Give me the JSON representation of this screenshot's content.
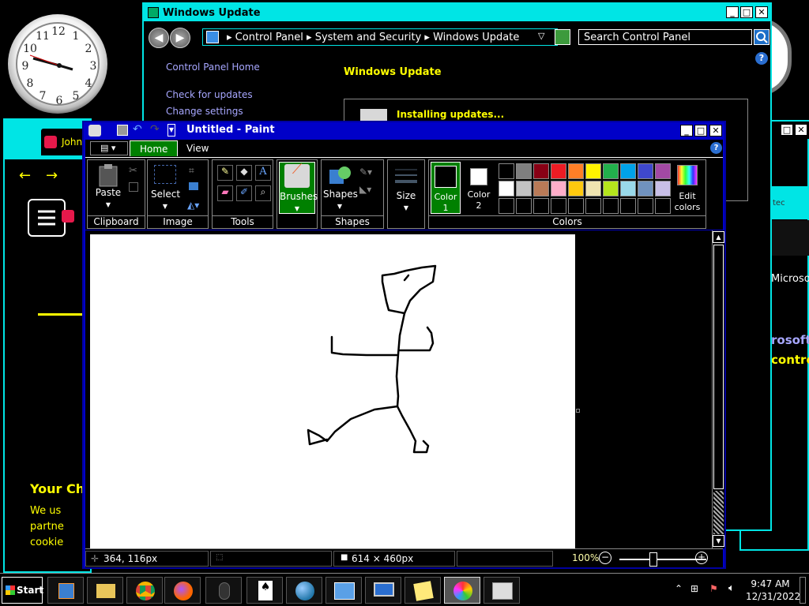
{
  "windows_update": {
    "title": "Windows Update",
    "breadcrumb": [
      "Control Panel",
      "System and Security",
      "Windows Update"
    ],
    "search_placeholder": "Search Control Panel",
    "sidebar_links": [
      "Control Panel Home",
      "Check for updates",
      "Change settings"
    ],
    "heading": "Windows Update",
    "status": "Installing updates..."
  },
  "paint": {
    "title": "Untitled - Paint",
    "tabs": [
      "Home",
      "View"
    ],
    "groups": {
      "clipboard": "Clipboard",
      "image": "Image",
      "tools": "Tools",
      "shapes": "Shapes",
      "colors": "Colors"
    },
    "buttons": {
      "paste": "Paste",
      "select": "Select",
      "brushes": "Brushes",
      "shapes": "Shapes",
      "size": "Size",
      "color1": "Color 1",
      "color2": "Color 2",
      "edit_colors": "Edit colors"
    },
    "palette_row1": [
      "#000000",
      "#7f7f7f",
      "#880015",
      "#ed1c24",
      "#ff7f27",
      "#fff200",
      "#22b14c",
      "#00a2e8",
      "#3f48cc",
      "#a349a4"
    ],
    "palette_row2": [
      "#ffffff",
      "#c3c3c3",
      "#b97a57",
      "#ffaec9",
      "#ffc90e",
      "#efe4b0",
      "#b5e61d",
      "#99d9ea",
      "#7092be",
      "#c8bfe7"
    ],
    "status": {
      "cursor_pos": "364, 116px",
      "canvas_size": "614 × 460px",
      "zoom": "100%"
    }
  },
  "browser_bg": {
    "tab_text": "John",
    "heading": "Your Che",
    "lines": [
      "We us",
      "partne",
      "cookie"
    ]
  },
  "right_bg": {
    "texts": [
      "tec",
      "Microso",
      "rosoft",
      "contro"
    ]
  },
  "taskbar": {
    "start_label": "Start",
    "time": "9:47 AM",
    "date": "12/31/2022"
  }
}
